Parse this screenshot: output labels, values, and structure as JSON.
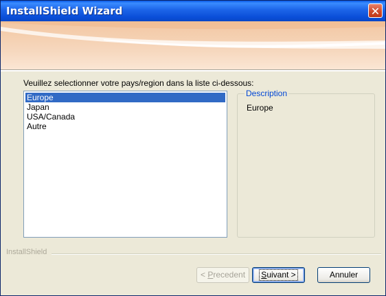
{
  "window": {
    "title": "InstallShield Wizard"
  },
  "instruction": "Veuillez selectionner votre pays/region dans la liste ci-dessous:",
  "list": {
    "items": [
      "Europe",
      "Japan",
      "USA/Canada",
      "Autre"
    ],
    "selected": "Europe"
  },
  "description": {
    "title": "Description",
    "text": "Europe"
  },
  "brand": "InstallShield",
  "buttons": {
    "back_prefix": "< ",
    "back_accel": "P",
    "back_rest": "recedent",
    "next_accel": "S",
    "next_rest": "uivant >",
    "cancel": "Annuler"
  },
  "colors": {
    "titlebar": "#0a4ed8",
    "selection": "#316ac5",
    "group_title": "#0046d5",
    "close": "#cf4b2b"
  }
}
